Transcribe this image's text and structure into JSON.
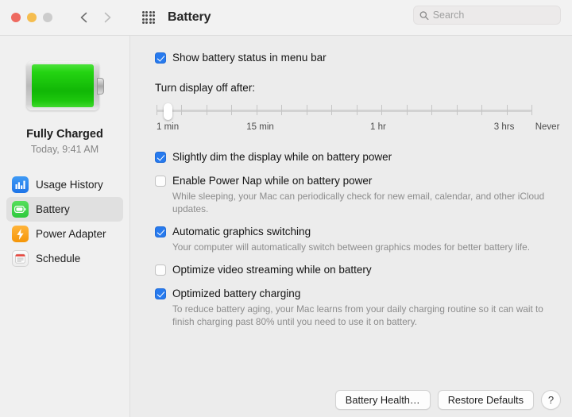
{
  "window": {
    "title": "Battery",
    "traffic_lights": [
      "close",
      "minimize",
      "maximize"
    ],
    "back_icon": "chevron-left-icon",
    "forward_icon": "chevron-right-icon",
    "grid_icon": "grid-apps-icon"
  },
  "search": {
    "placeholder": "Search",
    "value": "",
    "icon": "search-icon"
  },
  "sidebar": {
    "battery_icon": "large-battery-full-icon",
    "charge_status": "Fully Charged",
    "charge_time": "Today, 9:41 AM",
    "items": [
      {
        "label": "Usage History",
        "icon": "bar-chart-icon",
        "selected": false
      },
      {
        "label": "Battery",
        "icon": "battery-icon",
        "selected": true
      },
      {
        "label": "Power Adapter",
        "icon": "lightning-bolt-icon",
        "selected": false
      },
      {
        "label": "Schedule",
        "icon": "calendar-icon",
        "selected": false
      }
    ]
  },
  "main": {
    "menu_bar_option": {
      "label": "Show battery status in menu bar",
      "checked": true
    },
    "slider": {
      "label": "Turn display off after:",
      "thumb_position_percent": 3,
      "tick_count": 16,
      "tick_labels": [
        {
          "text": "1 min",
          "percent": 0
        },
        {
          "text": "15 min",
          "percent": 24
        },
        {
          "text": "1 hr",
          "percent": 57
        },
        {
          "text": "3 hrs",
          "percent": 90
        },
        {
          "text": "Never",
          "percent": 101
        }
      ]
    },
    "options": [
      {
        "label": "Slightly dim the display while on battery power",
        "checked": true,
        "helper": ""
      },
      {
        "label": "Enable Power Nap while on battery power",
        "checked": false,
        "helper": "While sleeping, your Mac can periodically check for new email, calendar, and other iCloud updates."
      },
      {
        "label": "Automatic graphics switching",
        "checked": true,
        "helper": "Your computer will automatically switch between graphics modes for better battery life."
      },
      {
        "label": "Optimize video streaming while on battery",
        "checked": false,
        "helper": ""
      },
      {
        "label": "Optimized battery charging",
        "checked": true,
        "helper": "To reduce battery aging, your Mac learns from your daily charging routine so it can wait to finish charging past 80% until you need to use it on battery."
      }
    ]
  },
  "footer": {
    "battery_health_label": "Battery Health…",
    "restore_defaults_label": "Restore Defaults",
    "help_label": "?"
  },
  "colors": {
    "accent_blue": "#277aee",
    "battery_green": "#24d412",
    "window_bg": "#ececec",
    "sidebar_bg": "#f0f0f0",
    "titlebar_bg": "#f2f2f2"
  }
}
